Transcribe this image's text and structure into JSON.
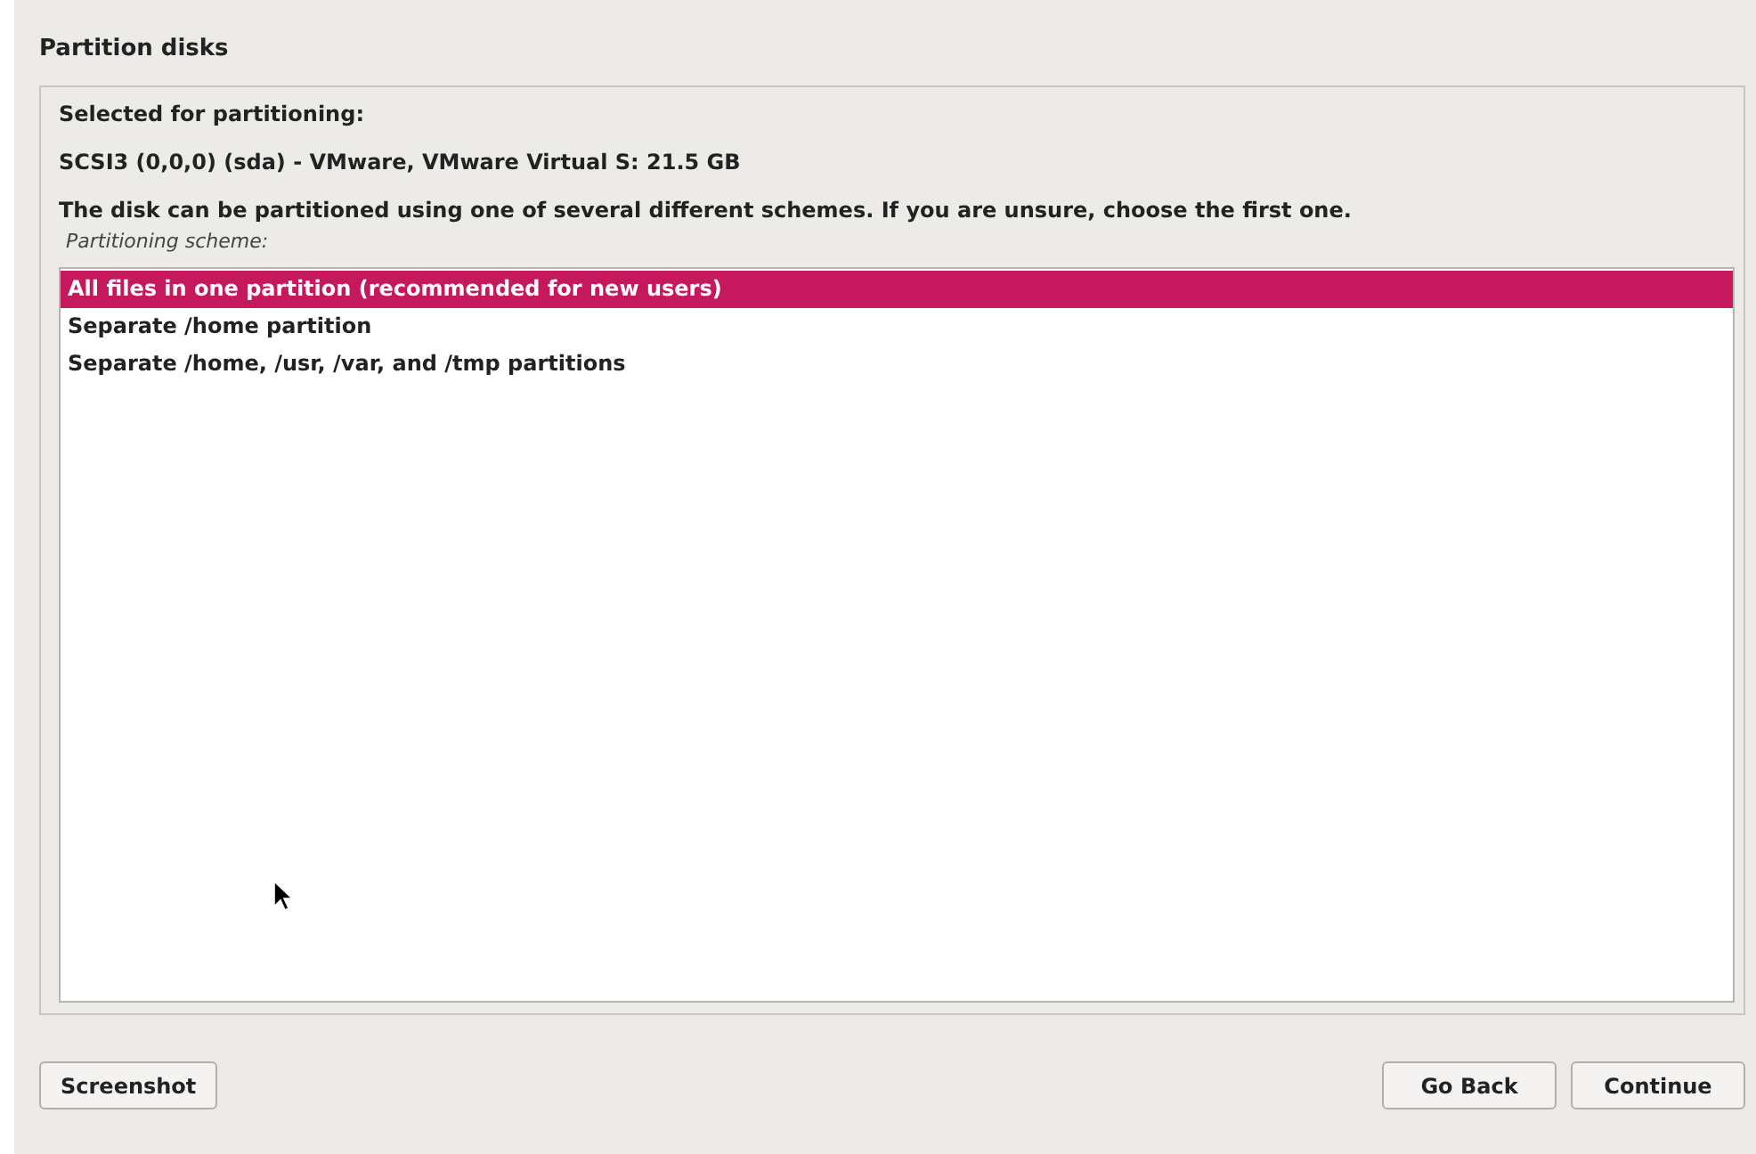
{
  "window": {
    "title": "Partition disks"
  },
  "selected_label": "Selected for partitioning:",
  "disk": "SCSI3 (0,0,0) (sda) - VMware, VMware Virtual S: 21.5 GB",
  "description": "The disk can be partitioned using one of several different schemes. If you are unsure, choose the first one.",
  "list_label": "Partitioning scheme:",
  "schemes": [
    {
      "label": "All files in one partition (recommended for new users)",
      "selected": true
    },
    {
      "label": "Separate /home partition",
      "selected": false
    },
    {
      "label": "Separate /home, /usr, /var, and /tmp partitions",
      "selected": false
    }
  ],
  "buttons": {
    "left": [
      "Screenshot"
    ],
    "right": [
      "Go Back",
      "Continue"
    ]
  }
}
